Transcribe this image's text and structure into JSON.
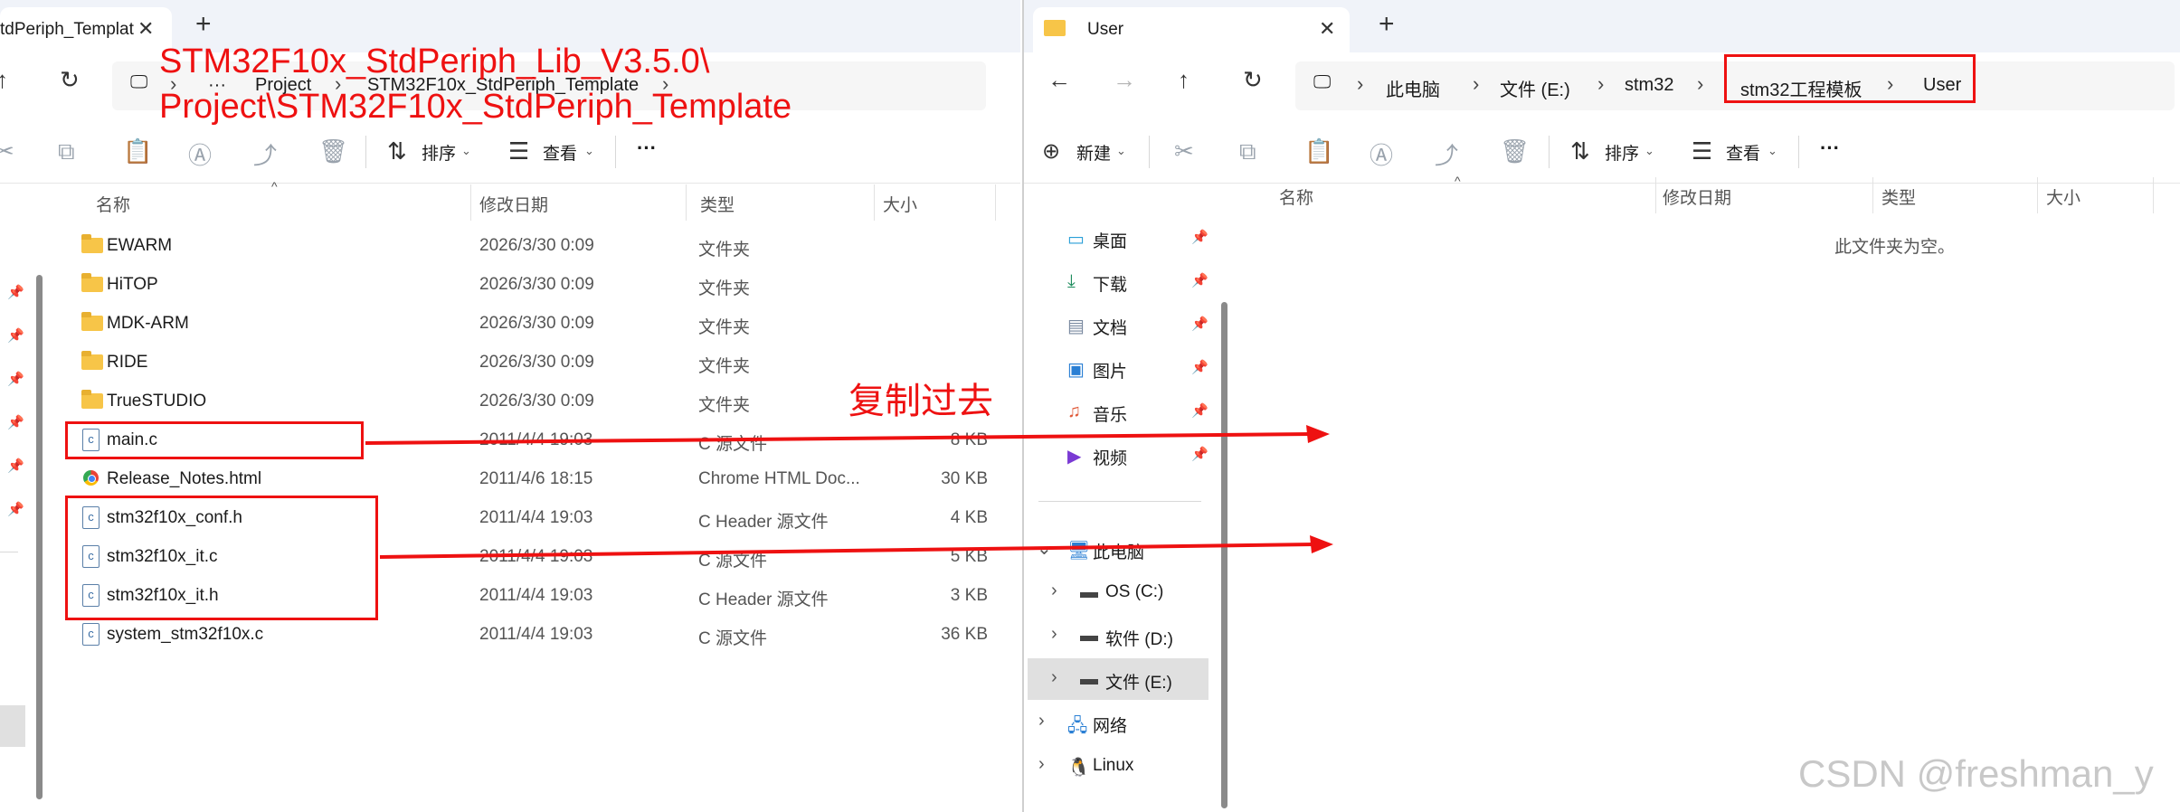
{
  "left_window": {
    "tab_title": "tdPeriph_Templat",
    "breadcrumb": [
      "···",
      "Project",
      "STM32F10x_StdPeriph_Template"
    ],
    "toolbar": {
      "sort_label": "排序",
      "view_label": "查看",
      "more_label": "···"
    },
    "columns": {
      "name": "名称",
      "date": "修改日期",
      "type": "类型",
      "size": "大小"
    },
    "files": [
      {
        "name": "EWARM",
        "date": "2026/3/30 0:09",
        "type": "文件夹",
        "size": "",
        "icon": "folder-icon"
      },
      {
        "name": "HiTOP",
        "date": "2026/3/30 0:09",
        "type": "文件夹",
        "size": "",
        "icon": "folder-icon"
      },
      {
        "name": "MDK-ARM",
        "date": "2026/3/30 0:09",
        "type": "文件夹",
        "size": "",
        "icon": "folder-icon"
      },
      {
        "name": "RIDE",
        "date": "2026/3/30 0:09",
        "type": "文件夹",
        "size": "",
        "icon": "folder-icon"
      },
      {
        "name": "TrueSTUDIO",
        "date": "2026/3/30 0:09",
        "type": "文件夹",
        "size": "",
        "icon": "folder-icon"
      },
      {
        "name": "main.c",
        "date": "2011/4/4 19:03",
        "type": "C 源文件",
        "size": "8 KB",
        "icon": "c-file-icon"
      },
      {
        "name": "Release_Notes.html",
        "date": "2011/4/6 18:15",
        "type": "Chrome HTML Doc...",
        "size": "30 KB",
        "icon": "chrome-icon"
      },
      {
        "name": "stm32f10x_conf.h",
        "date": "2011/4/4 19:03",
        "type": "C Header 源文件",
        "size": "4 KB",
        "icon": "c-file-icon"
      },
      {
        "name": "stm32f10x_it.c",
        "date": "2011/4/4 19:03",
        "type": "C 源文件",
        "size": "5 KB",
        "icon": "c-file-icon"
      },
      {
        "name": "stm32f10x_it.h",
        "date": "2011/4/4 19:03",
        "type": "C Header 源文件",
        "size": "3 KB",
        "icon": "c-file-icon"
      },
      {
        "name": "system_stm32f10x.c",
        "date": "2011/4/4 19:03",
        "type": "C 源文件",
        "size": "36 KB",
        "icon": "c-file-icon"
      }
    ]
  },
  "right_window": {
    "tab_title": "User",
    "breadcrumb": [
      "此电脑",
      "文件 (E:)",
      "stm32",
      "stm32工程模板",
      "User"
    ],
    "toolbar": {
      "new_label": "新建",
      "sort_label": "排序",
      "view_label": "查看",
      "more_label": "···"
    },
    "columns": {
      "name": "名称",
      "date": "修改日期",
      "type": "类型",
      "size": "大小"
    },
    "empty_message": "此文件夹为空。",
    "quick_access": [
      {
        "label": "桌面",
        "icon": "desktop-icon"
      },
      {
        "label": "下载",
        "icon": "download-icon"
      },
      {
        "label": "文档",
        "icon": "documents-icon"
      },
      {
        "label": "图片",
        "icon": "pictures-icon"
      },
      {
        "label": "音乐",
        "icon": "music-icon"
      },
      {
        "label": "视频",
        "icon": "videos-icon"
      }
    ],
    "this_pc": "此电脑",
    "drives": [
      {
        "label": "OS (C:)"
      },
      {
        "label": "软件 (D:)"
      },
      {
        "label": "文件 (E:)"
      }
    ],
    "network": "网络",
    "linux": "Linux"
  },
  "annotations": {
    "path_note_line1": "STM32F10x_StdPeriph_Lib_V3.5.0\\",
    "path_note_line2": "Project\\STM32F10x_StdPeriph_Template",
    "copy_note": "复制过去",
    "color": "#ee1111"
  },
  "watermark": "CSDN @freshman_y"
}
